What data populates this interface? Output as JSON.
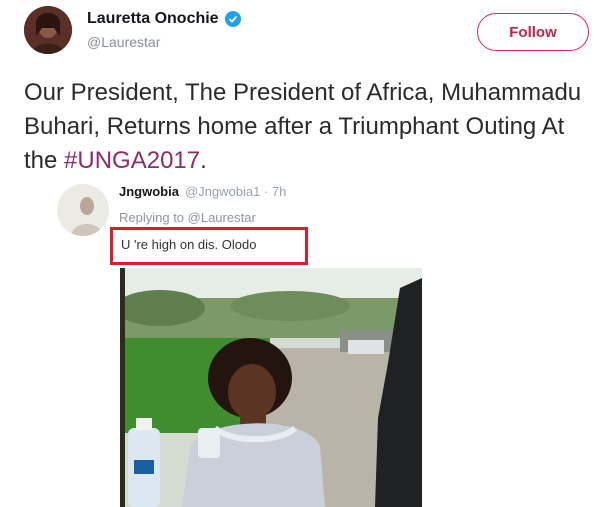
{
  "tweet": {
    "author_name": "Lauretta Onochie",
    "author_handle": "@Laurestar",
    "follow_label": "Follow",
    "text_main": "Our President, The President of Africa, Muhammadu Buhari, Returns home after a Triumphant Outing At the ",
    "hashtag": "#UNGA2017",
    "text_end": "."
  },
  "reply": {
    "author_name": "Jngwobia",
    "author_handle": "@Jngwobia1 · 7h",
    "replying_to": "Replying to @Laurestar",
    "text": "U 're high on dis. Olodo"
  },
  "colors": {
    "follow_accent": "#e0245e",
    "hashtag": "#8e2c6a",
    "highlight_box": "#d81e2c",
    "verified": "#1da1f2"
  },
  "icons": [
    "verified-badge-icon"
  ]
}
